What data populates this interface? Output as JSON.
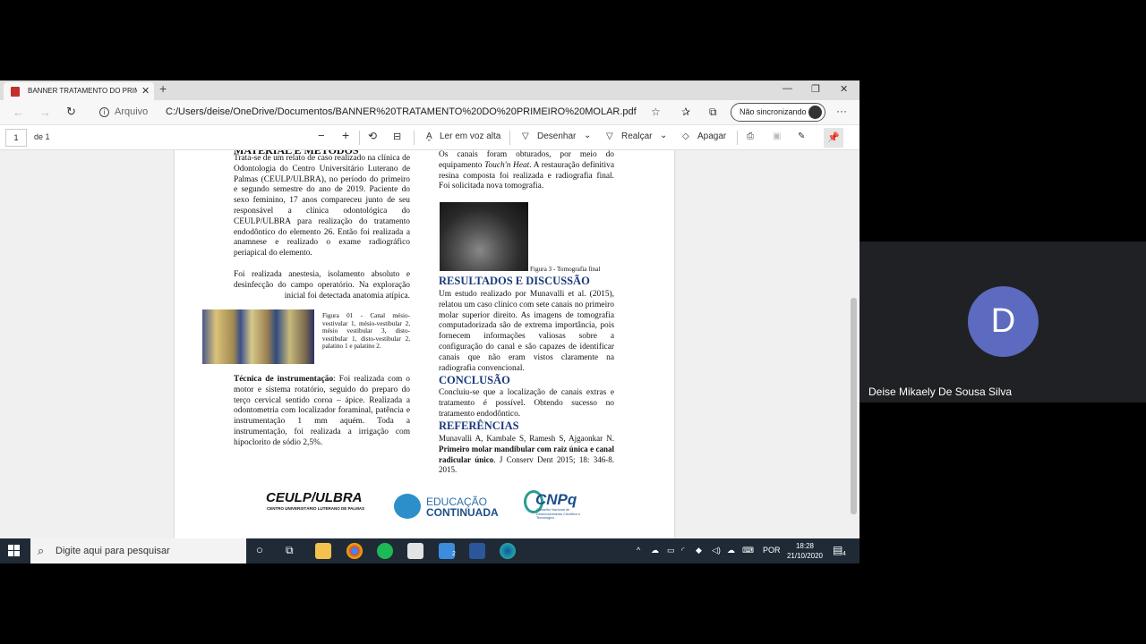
{
  "browser": {
    "tab_title": "BANNER TRATAMENTO DO PRIMEIRO MOLAR.pdf",
    "new_tab": "+",
    "scheme_label": "Arquivo",
    "url": "C:/Users/deise/OneDrive/Documentos/BANNER%20TRATAMENTO%20DO%20PRIMEIRO%20MOLAR.pdf",
    "sync_label": "Não sincronizando",
    "more": "···"
  },
  "pdf_toolbar": {
    "page_number": "1",
    "page_count": "de 1",
    "read_aloud": "Ler em voz alta",
    "draw": "Desenhar",
    "highlight": "Realçar",
    "erase": "Apagar"
  },
  "document": {
    "material_heading": "MATERIAL E MÉTODOS",
    "material_p1": "Trata-se de um relato de caso realizado na clínica de Odontologia do Centro Universitário Luterano de Palmas (CEULP/ULBRA), no período do primeiro e segundo semestre do ano de 2019. Paciente do sexo feminino, 17 anos compareceu junto de seu responsável a clínica odontológica do CEULP/ULBRA para realização do tratamento endodôntico do elemento 26. Então foi realizada a anamnese e realizado o exame radiográfico periapical do elemento.",
    "material_p2": "Foi realizada anestesia, isolamento absoluto e desinfecção do campo operatório. Na exploração inicial foi detectada anatomia atípica.",
    "figure1_caption": "Figura 01 - Canal mésio-vestivular 1, mésio-vestibular 2, mésio vestibular 3, disto-vestibular 1, disto-vestibular 2, palatino 1 e palatino 2.",
    "technique_label": "Técnica de instrumentação",
    "technique_text": ": Foi realizada com o motor e sistema rotatório, seguido do preparo do terço cervical sentido coroa – ápice. Realizada a odontometria com localizador foraminal, patência e instrumentação 1 mm aquém. Toda a instrumentação, foi realizada a irrigação com hipoclorito de sódio 2,5%.",
    "right_p1_a": "Os canais foram obturados, por meio do equipamento ",
    "right_p1_em": "Touch'n Heat",
    "right_p1_b": ". A restauração definitiva resina composta foi realizada e radiografia final. Foi solicitada nova tomografia.",
    "figure3_caption": "Figura 3 - Tomografia final",
    "results_heading": "RESULTADOS E DISCUSSÃO",
    "results_text": "Um estudo realizado por Munavalli et al. (2015), relatou um caso clínico com sete canais no primeiro molar superior direito. As imagens de tomografia computadorizada são de extrema importância, pois fornecem informações valiosas sobre a configuração do canal e são capazes de identificar canais que não eram vistos claramente na radiografia convencional.",
    "conclusion_heading": "CONCLUSÃO",
    "conclusion_text": "Concluiu-se que a localização de canais extras e tratamento é possível. Obtendo sucesso no tratamento endodôntico.",
    "references_heading": "REFERÊNCIAS",
    "reference_authors": "Munavalli A, Kambale S, Ramesh S, Ajgaonkar N. ",
    "reference_title": "Primeiro molar mandibular com raiz única e canal radicular único",
    "reference_source": ". J Conserv Dent 2015; 18: 346-8. 2015.",
    "logo_ceulp": "CEULP/ULBRA",
    "logo_ceulp_sub": "CENTRO UNIVERSITÁRIO LUTERANO DE PALMAS",
    "logo_educacao_1": "EDUCAÇÃO",
    "logo_educacao_2": "CONTINUADA",
    "logo_cnpq": "CNPq",
    "logo_cnpq_sub": "Conselho Nacional de Desenvolvimento Científico e Tecnológico"
  },
  "taskbar": {
    "search_placeholder": "Digite aqui para pesquisar",
    "language": "POR",
    "time": "18:28",
    "date": "21/10/2020",
    "notifications": "4",
    "mail_badge": "2"
  },
  "participant": {
    "initial": "D",
    "name": "Deise Mikaely De Sousa Silva"
  },
  "colors": {
    "heading_blue": "#1a3a7a",
    "avatar": "#5c6bc0",
    "taskbar": "#1f2a36",
    "tile_bg": "#202124"
  }
}
